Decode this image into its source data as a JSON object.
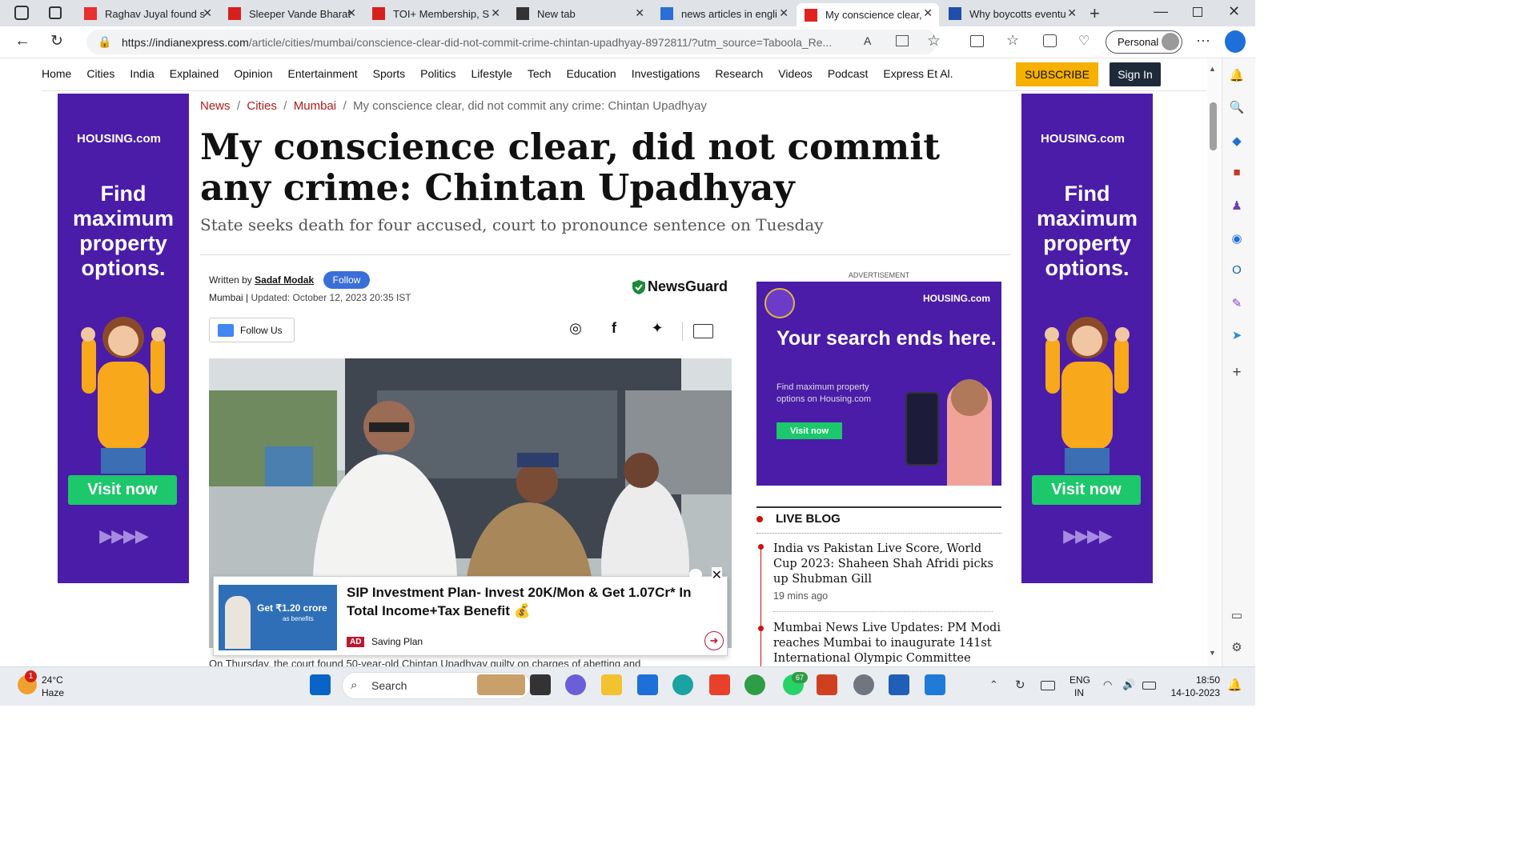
{
  "browser": {
    "tabs": [
      {
        "label": "Raghav Juyal found s",
        "fav_color": "#e8302e"
      },
      {
        "label": "Sleeper Vande Bharat",
        "fav_color": "#d6201c"
      },
      {
        "label": "TOI+ Membership, S",
        "fav_color": "#d6201c"
      },
      {
        "label": "New tab",
        "fav_color": "#333333"
      },
      {
        "label": "news articles in engli",
        "fav_color": "#2b6fd6"
      },
      {
        "label": "My conscience clear,",
        "fav_color": "#e0231f"
      },
      {
        "label": "Why boycotts eventu",
        "fav_color": "#1f4fa8"
      }
    ],
    "url_host": "https://indianexpress.com",
    "url_path": "/article/cities/mumbai/conscience-clear-did-not-commit-crime-chintan-upadhyay-8972811/?utm_source=Taboola_Re...",
    "profile": "Personal"
  },
  "site": {
    "nav": [
      "Home",
      "Cities",
      "India",
      "Explained",
      "Opinion",
      "Entertainment",
      "Sports",
      "Politics",
      "Lifestyle",
      "Tech",
      "Education",
      "Investigations",
      "Research",
      "Videos",
      "Podcast",
      "Express Et Al."
    ],
    "subscribe": "SUBSCRIBE",
    "signin": "Sign In"
  },
  "side_ad": {
    "brand": "HOUSING.com",
    "headline": "Find maximum property options.",
    "cta": "Visit now",
    "arrows": "▶▶▶▶"
  },
  "article": {
    "breadcrumb": [
      "News",
      "Cities",
      "Mumbai"
    ],
    "breadcrumb_current": "My conscience clear, did not commit any crime: Chintan Upadhyay",
    "headline": "My conscience clear, did not commit any crime: Chintan Upadhyay",
    "subhead": "State seeks death for four accused, court to pronounce sentence on Tuesday",
    "written_by": "Written by",
    "author": "Sadaf Modak",
    "follow": "Follow",
    "location": "Mumbai",
    "updated": "Updated: October 12, 2023 20:35 IST",
    "newsguard": "NewsGuard",
    "follow_us": "Follow Us",
    "cut_text": "On Thursday, the court found 50-year-old Chintan Upadhyay guilty on charges of abetting and"
  },
  "popup_ad": {
    "title": "SIP Investment Plan- Invest 20K/Mon & Get 1.07Cr* In Total Income+Tax Benefit 💰",
    "badge": "AD",
    "sponsor": "Saving Plan",
    "thumb_text": "Get ₹1.20 crore",
    "thumb_sub": "as benefits"
  },
  "right_ad": {
    "label": "ADVERTISEMENT",
    "brand": "HOUSING.com",
    "headline": "Your search ends here.",
    "para": "Find maximum property options on Housing.com",
    "cta": "Visit now"
  },
  "live_blog": {
    "title": "LIVE BLOG",
    "items": [
      {
        "text": "India vs Pakistan Live Score, World Cup 2023: Shaheen Shah Afridi picks up Shubman Gill",
        "time": "19 mins ago"
      },
      {
        "text": "Mumbai News Live Updates: PM Modi reaches Mumbai to inaugurate 141st International Olympic Committee"
      }
    ]
  },
  "taskbar": {
    "weather_temp": "24°C",
    "weather_desc": "Haze",
    "weather_badge": "1",
    "search": "Search",
    "whatsapp_badge": "67",
    "lang1": "ENG",
    "lang2": "IN",
    "time": "18:50",
    "date": "14-10-2023"
  }
}
